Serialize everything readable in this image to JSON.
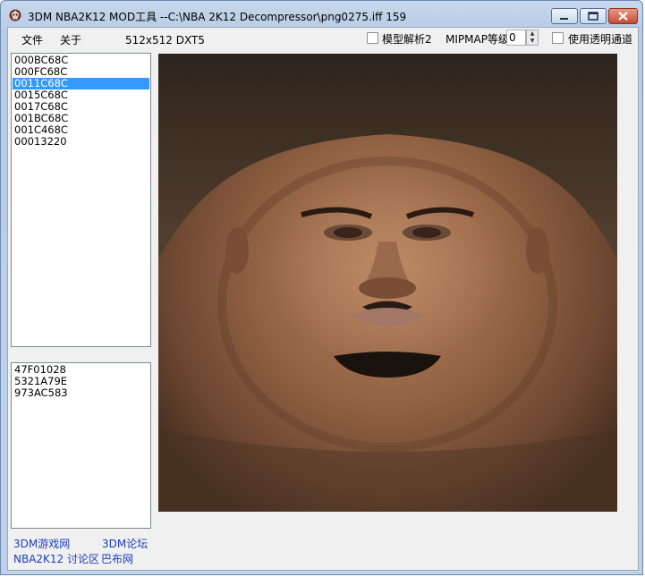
{
  "window": {
    "title": "3DM NBA2K12 MOD工具  --C:\\NBA 2K12 Decompressor\\png0275.iff  159"
  },
  "menu": {
    "file": "文件",
    "about": "关于"
  },
  "texture_info": "512x512 DXT5",
  "options": {
    "model_parse_label": "模型解析2",
    "mipmap_label": "MIPMAP等级",
    "mipmap_value": "0",
    "use_alpha_label": "使用透明通道"
  },
  "texture_list": {
    "items": [
      "000BC68C",
      "000FC68C",
      "0011C68C",
      "0015C68C",
      "0017C68C",
      "001BC68C",
      "001C468C",
      "00013220"
    ],
    "selected_index": 2
  },
  "hash_list": {
    "items": [
      "47F01028",
      "5321A79E",
      "973AC583"
    ]
  },
  "links": {
    "site": "3DM游戏网",
    "forum": "3DM论坛",
    "nba_forum": "NBA2K12 讨论区",
    "baibu": "巴布网"
  },
  "colors": {
    "selection": "#3399ff",
    "link": "#1a3fbf",
    "close_button": "#c94a35"
  }
}
